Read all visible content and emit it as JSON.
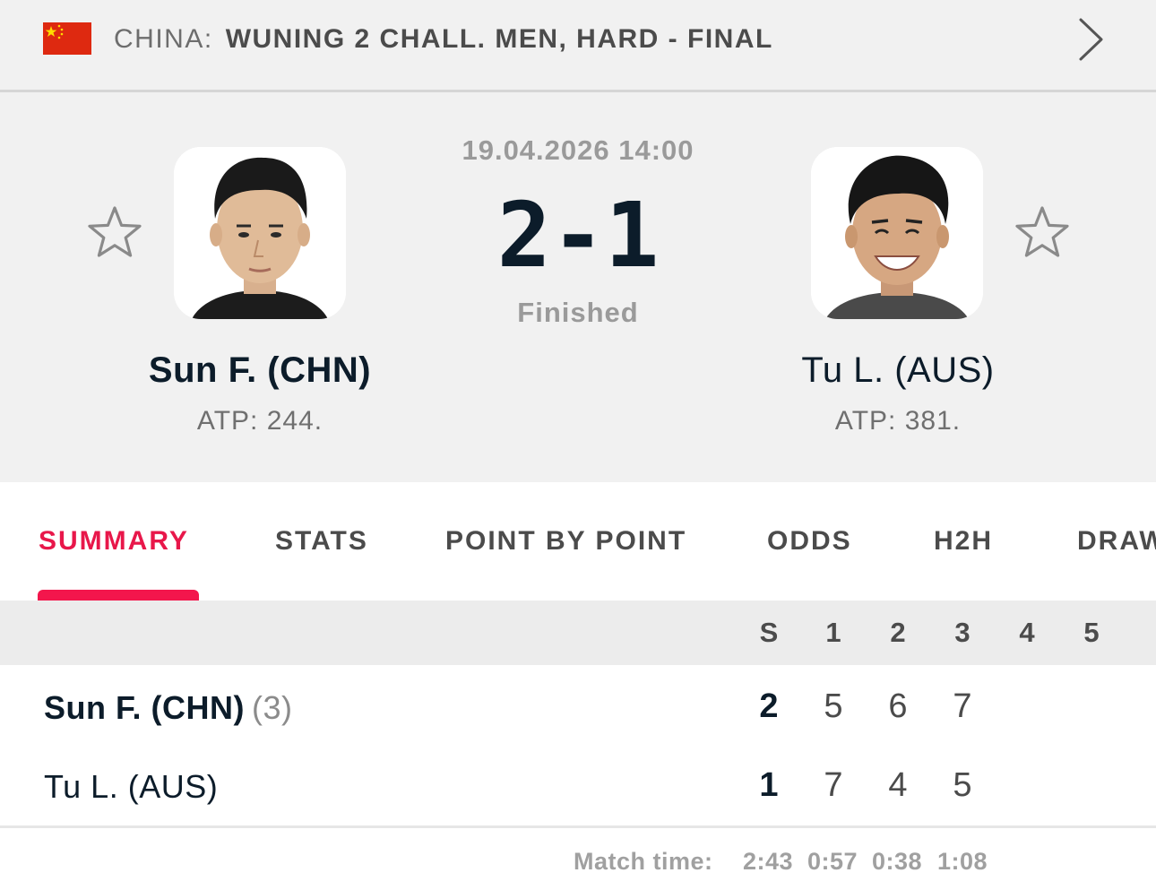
{
  "tournament": {
    "country": "CHINA:",
    "name": "WUNING 2 CHALL. MEN, HARD - FINAL",
    "flag_icon": "flag-china",
    "colors": {
      "flag_red": "#de2910",
      "flag_yellow": "#ffde00"
    }
  },
  "match": {
    "date": "19.04.2026 14:00",
    "score": "2-1",
    "status": "Finished"
  },
  "home": {
    "name": "Sun F. (CHN)",
    "rank": "ATP: 244.",
    "seed": "(3)"
  },
  "away": {
    "name": "Tu L. (AUS)",
    "rank": "ATP: 381."
  },
  "tabs": [
    {
      "label": "SUMMARY",
      "active": true
    },
    {
      "label": "STATS",
      "active": false
    },
    {
      "label": "POINT BY POINT",
      "active": false
    },
    {
      "label": "ODDS",
      "active": false
    },
    {
      "label": "H2H",
      "active": false
    },
    {
      "label": "DRAW",
      "active": false
    }
  ],
  "scoreboard": {
    "columns": [
      "S",
      "1",
      "2",
      "3",
      "4",
      "5"
    ],
    "rows": [
      {
        "player": "Sun F. (CHN)",
        "seed": "(3)",
        "sets": "2",
        "games": [
          "5",
          "6",
          "7",
          "",
          ""
        ]
      },
      {
        "player": "Tu L. (AUS)",
        "seed": "",
        "sets": "1",
        "games": [
          "7",
          "4",
          "5",
          "",
          ""
        ]
      }
    ],
    "match_time_label": "Match time:",
    "match_time_total": "2:43",
    "set_times": [
      "0:57",
      "0:38",
      "1:08"
    ]
  },
  "colors": {
    "accent": "#f3164c",
    "text_dark": "#0c1c2a",
    "header_bg": "#f1f1f1"
  }
}
